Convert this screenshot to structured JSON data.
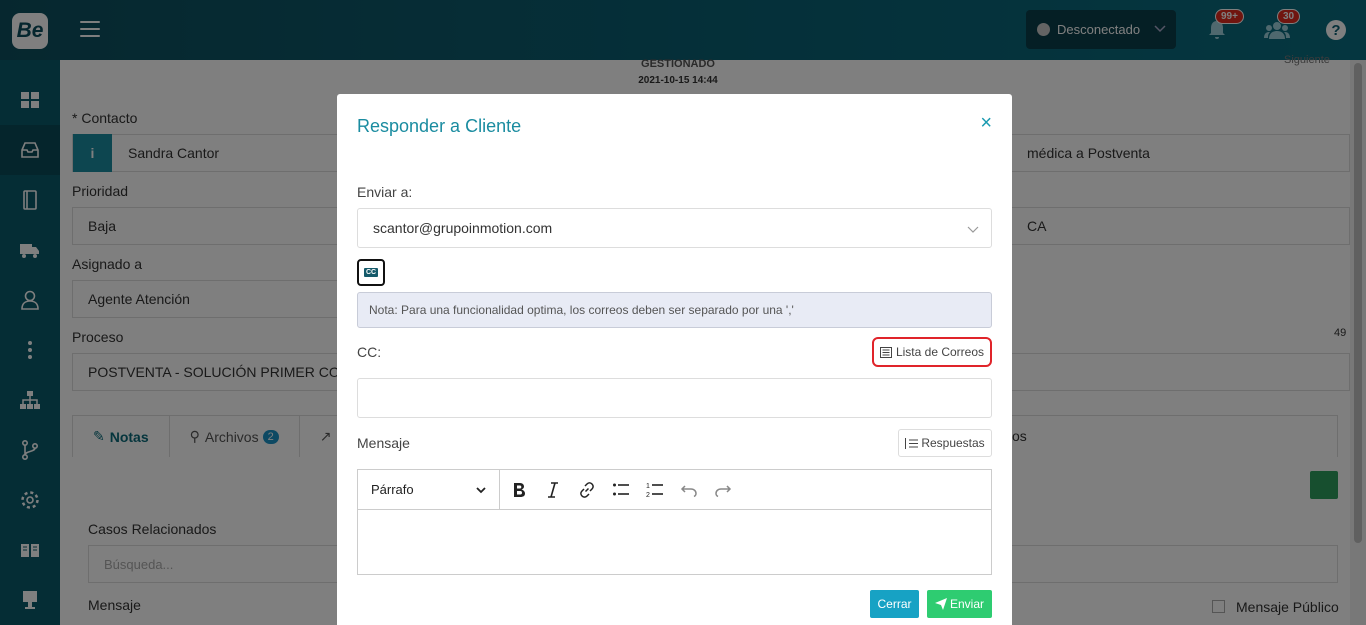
{
  "app": {
    "logo": "Be"
  },
  "header": {
    "status": "Desconectado",
    "notifications_badge": "99+",
    "users_badge": "30",
    "help": "?"
  },
  "sidebar": {
    "items": [
      {
        "icon": "dashboard-icon"
      },
      {
        "icon": "inbox-icon"
      },
      {
        "icon": "book-icon"
      },
      {
        "icon": "truck-icon"
      },
      {
        "icon": "user-icon"
      },
      {
        "icon": "more-vertical-icon"
      },
      {
        "icon": "hierarchy-icon"
      },
      {
        "icon": "branch-icon"
      },
      {
        "icon": "gear-icon"
      },
      {
        "icon": "open-book-icon"
      },
      {
        "icon": "kiosk-icon"
      }
    ]
  },
  "background": {
    "status_title": "GESTIONADO",
    "status_date": "2021-10-15 14:44",
    "siguiente": "Siguiente",
    "contacto_label": "* Contacto",
    "contacto_value": "Sandra Cantor",
    "prioridad_label": "Prioridad",
    "prioridad_value": "Baja",
    "asignado_label": "Asignado a",
    "asignado_value": "Agente Atención",
    "proceso_label": "Proceso",
    "proceso_value": "POSTVENTA - SOLUCIÓN PRIMER CON",
    "right_select_1": "médica a Postventa",
    "right_select_2": "CA",
    "right_number": "49",
    "tab_notas": "Notas",
    "tab_archivos": "Archivos",
    "tab_archivos_count": "2",
    "tab_right": "os",
    "casos_label": "Casos Relacionados",
    "busqueda_placeholder": "Búsqueda...",
    "mensaje_label": "Mensaje",
    "mensaje_publico": "Mensaje Público"
  },
  "modal": {
    "title": "Responder a Cliente",
    "close": "×",
    "enviar_a_label": "Enviar a:",
    "enviar_a_value": "scantor@grupoinmotion.com",
    "cc_toggle": "CC",
    "note": "Nota: Para una funcionalidad optima, los correos deben ser separado por una ','",
    "cc_label": "CC:",
    "lista_correos": "Lista de Correos",
    "mensaje_label": "Mensaje",
    "respuestas": "Respuestas",
    "paragraph_select": "Párrafo",
    "cerrar": "Cerrar",
    "enviar": "Enviar"
  }
}
